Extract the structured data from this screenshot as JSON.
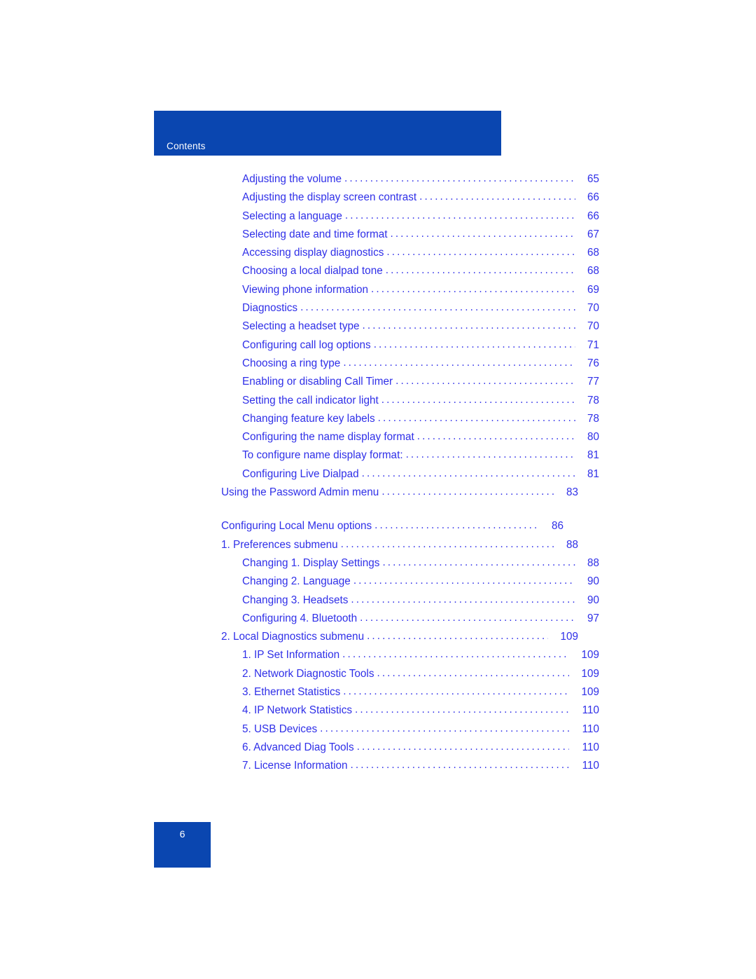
{
  "header": {
    "title": "Contents",
    "band_color": "#0A46B0"
  },
  "footer": {
    "page_number": "6",
    "box_color": "#0A46B0"
  },
  "colors": {
    "link_text": "#2F2FE8",
    "band": "#0A46B0",
    "page_background": "#FFFFFF"
  },
  "toc": {
    "entries": [
      {
        "label": "Adjusting the volume",
        "page": "65",
        "level": 2,
        "gap_before": false
      },
      {
        "label": "Adjusting the display screen contrast",
        "page": "66",
        "level": 2,
        "gap_before": false
      },
      {
        "label": "Selecting a language",
        "page": "66",
        "level": 2,
        "gap_before": false
      },
      {
        "label": "Selecting date and time format",
        "page": "67",
        "level": 2,
        "gap_before": false
      },
      {
        "label": "Accessing display diagnostics",
        "page": "68",
        "level": 2,
        "gap_before": false
      },
      {
        "label": "Choosing a local dialpad tone",
        "page": "68",
        "level": 2,
        "gap_before": false
      },
      {
        "label": "Viewing phone information",
        "page": "69",
        "level": 2,
        "gap_before": false
      },
      {
        "label": "Diagnostics",
        "page": "70",
        "level": 2,
        "gap_before": false
      },
      {
        "label": "Selecting a headset type",
        "page": "70",
        "level": 2,
        "gap_before": false
      },
      {
        "label": "Configuring call log options",
        "page": "71",
        "level": 2,
        "gap_before": false
      },
      {
        "label": "Choosing a ring type",
        "page": "76",
        "level": 2,
        "gap_before": false
      },
      {
        "label": "Enabling or disabling Call Timer",
        "page": "77",
        "level": 2,
        "gap_before": false
      },
      {
        "label": "Setting the call indicator light",
        "page": "78",
        "level": 2,
        "gap_before": false
      },
      {
        "label": "Changing feature key labels",
        "page": "78",
        "level": 2,
        "gap_before": false
      },
      {
        "label": "Configuring the name display format",
        "page": "80",
        "level": 2,
        "gap_before": false
      },
      {
        "label": "To configure name display format:",
        "page": "81",
        "level": 2,
        "gap_before": false
      },
      {
        "label": "Configuring Live Dialpad",
        "page": "81",
        "level": 2,
        "gap_before": false
      },
      {
        "label": "Using the Password Admin menu",
        "page": "83",
        "level": 1,
        "gap_before": false
      },
      {
        "label": "Configuring Local Menu options",
        "page": "86",
        "level": 1,
        "gap_before": true,
        "short_right": true
      },
      {
        "label": "1. Preferences submenu",
        "page": "88",
        "level": 1,
        "gap_before": false
      },
      {
        "label": "Changing 1. Display Settings",
        "page": "88",
        "level": 2,
        "gap_before": false
      },
      {
        "label": "Changing 2. Language",
        "page": "90",
        "level": 2,
        "gap_before": false
      },
      {
        "label": "Changing 3. Headsets",
        "page": "90",
        "level": 2,
        "gap_before": false
      },
      {
        "label": "Configuring 4. Bluetooth",
        "page": "97",
        "level": 2,
        "gap_before": false
      },
      {
        "label": "2. Local Diagnostics submenu",
        "page": "109",
        "level": 1,
        "gap_before": false
      },
      {
        "label": "1. IP Set Information",
        "page": "109",
        "level": 2,
        "gap_before": false
      },
      {
        "label": "2. Network Diagnostic Tools",
        "page": "109",
        "level": 2,
        "gap_before": false
      },
      {
        "label": "3. Ethernet Statistics",
        "page": "109",
        "level": 2,
        "gap_before": false
      },
      {
        "label": "4. IP Network Statistics",
        "page": "110",
        "level": 2,
        "gap_before": false
      },
      {
        "label": "5. USB Devices",
        "page": "110",
        "level": 2,
        "gap_before": false
      },
      {
        "label": "6. Advanced Diag Tools",
        "page": "110",
        "level": 2,
        "gap_before": false
      },
      {
        "label": "7. License Information",
        "page": "110",
        "level": 2,
        "gap_before": false
      }
    ]
  }
}
